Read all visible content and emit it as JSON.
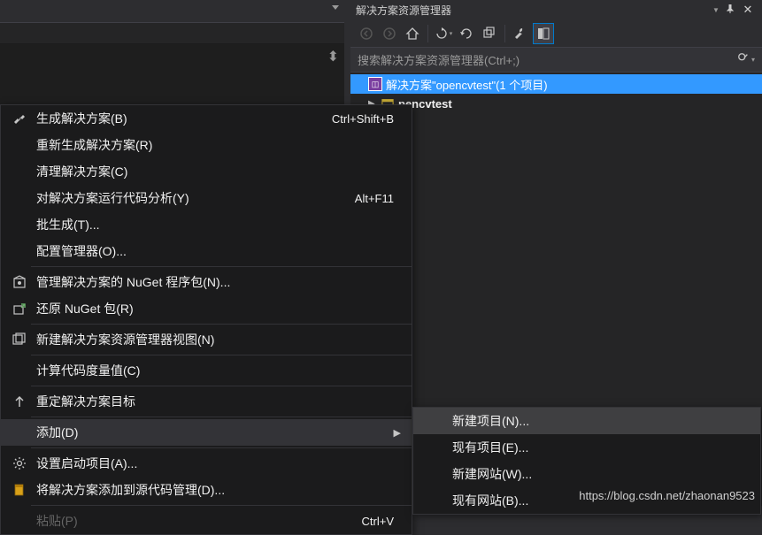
{
  "solution_explorer": {
    "title": "解决方案资源管理器",
    "search_placeholder": "搜索解决方案资源管理器(Ctrl+;)",
    "solution_label": "解决方案\"opencvtest\"(1 个项目)",
    "project_label": "pencvtest"
  },
  "context_menu": {
    "items": [
      {
        "icon": "build",
        "label": "生成解决方案(B)",
        "shortcut": "Ctrl+Shift+B"
      },
      {
        "icon": "",
        "label": "重新生成解决方案(R)",
        "shortcut": ""
      },
      {
        "icon": "",
        "label": "清理解决方案(C)",
        "shortcut": ""
      },
      {
        "icon": "",
        "label": "对解决方案运行代码分析(Y)",
        "shortcut": "Alt+F11"
      },
      {
        "icon": "",
        "label": "批生成(T)...",
        "shortcut": ""
      },
      {
        "icon": "",
        "label": "配置管理器(O)...",
        "shortcut": ""
      },
      {
        "sep": true
      },
      {
        "icon": "nuget",
        "label": "管理解决方案的 NuGet 程序包(N)...",
        "shortcut": ""
      },
      {
        "icon": "restore",
        "label": "还原 NuGet 包(R)",
        "shortcut": ""
      },
      {
        "sep": true
      },
      {
        "icon": "newview",
        "label": "新建解决方案资源管理器视图(N)",
        "shortcut": ""
      },
      {
        "sep": true
      },
      {
        "icon": "",
        "label": "计算代码度量值(C)",
        "shortcut": ""
      },
      {
        "sep": true
      },
      {
        "icon": "retarget",
        "label": "重定解决方案目标",
        "shortcut": ""
      },
      {
        "sep": true
      },
      {
        "icon": "",
        "label": "添加(D)",
        "shortcut": "",
        "arrow": true,
        "highlighted": true
      },
      {
        "sep": true
      },
      {
        "icon": "gear",
        "label": "设置启动项目(A)...",
        "shortcut": ""
      },
      {
        "icon": "source",
        "label": "将解决方案添加到源代码管理(D)...",
        "shortcut": ""
      },
      {
        "sep": true
      },
      {
        "icon": "",
        "label": "粘贴(P)",
        "shortcut": "Ctrl+V",
        "disabled": true
      }
    ]
  },
  "submenu": {
    "items": [
      {
        "label": "新建项目(N)...",
        "highlighted": true
      },
      {
        "label": "现有项目(E)..."
      },
      {
        "label": "新建网站(W)..."
      },
      {
        "label": "现有网站(B)..."
      }
    ]
  },
  "watermark": "https://blog.csdn.net/zhaonan9523"
}
